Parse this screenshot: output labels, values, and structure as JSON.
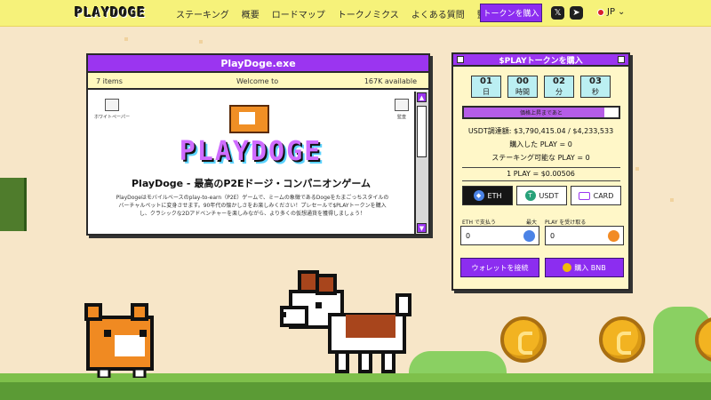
{
  "colors": {
    "brand_purple": "#9b35f0",
    "header_yellow": "#f6f27a",
    "panel_yellow": "#fff7c8",
    "sky": "#f7e6c8",
    "grass": "#7ec04b"
  },
  "header": {
    "logo": "PLAYDOGE",
    "nav": [
      "ステーキング",
      "概要",
      "ロードマップ",
      "トークノミクス",
      "よくある質問",
      "監査"
    ],
    "buy_button": "トークンを購入",
    "language": "JP",
    "icons": [
      "x-twitter-icon",
      "telegram-icon",
      "japan-flag-icon",
      "chevron-down-icon"
    ]
  },
  "window": {
    "title": "PlayDoge.exe",
    "status_left": "7 items",
    "status_center": "Welcome to",
    "status_right": "167K available",
    "desktop_icons": [
      "ホワイトペーパー",
      "監査"
    ],
    "logo_text": "PLAYDOGE",
    "hero_title": "PlayDoge - 最高のP2Eドージ・コンパニオンゲーム",
    "description": "PlayDogeはモバイルベースのplay-to-earn（P2E）ゲームで、ミームの象徴であるDogeをたまごっちスタイルのバーチャルペットに変身させます。90年代の懐かしさをお楽しみください！プレセールで$PLAYトークンを購入し、クラシックな2Dアドベンチャーを楽しみながら、より多くの仮想通貨を獲得しましょう！"
  },
  "presale": {
    "title": "$PLAYトークンを購入",
    "countdown": [
      {
        "value": "01",
        "unit": "日"
      },
      {
        "value": "00",
        "unit": "時間"
      },
      {
        "value": "02",
        "unit": "分"
      },
      {
        "value": "03",
        "unit": "秒"
      }
    ],
    "progress_label": "価格上昇まであと",
    "progress_fraction": 0.91,
    "raised": "USDT調達額: $3,790,415.04 / $4,233,533",
    "purchased": "購入した PLAY = 0",
    "stakeable": "ステーキング可能な PLAY = 0",
    "rate": "1 PLAY = $0.00506",
    "methods": [
      {
        "label": "ETH",
        "icon": "eth-icon",
        "selected": true
      },
      {
        "label": "USDT",
        "icon": "usdt-icon",
        "selected": false
      },
      {
        "label": "CARD",
        "icon": "card-icon",
        "selected": false
      }
    ],
    "pay_label": "ETH で支払う",
    "max_label": "最大",
    "receive_label": "PLAY を受け取る",
    "pay_value": "0",
    "receive_value": "0",
    "connect_button": "ウォレットを接続",
    "buy_bnb_button": "購入 BNB"
  }
}
